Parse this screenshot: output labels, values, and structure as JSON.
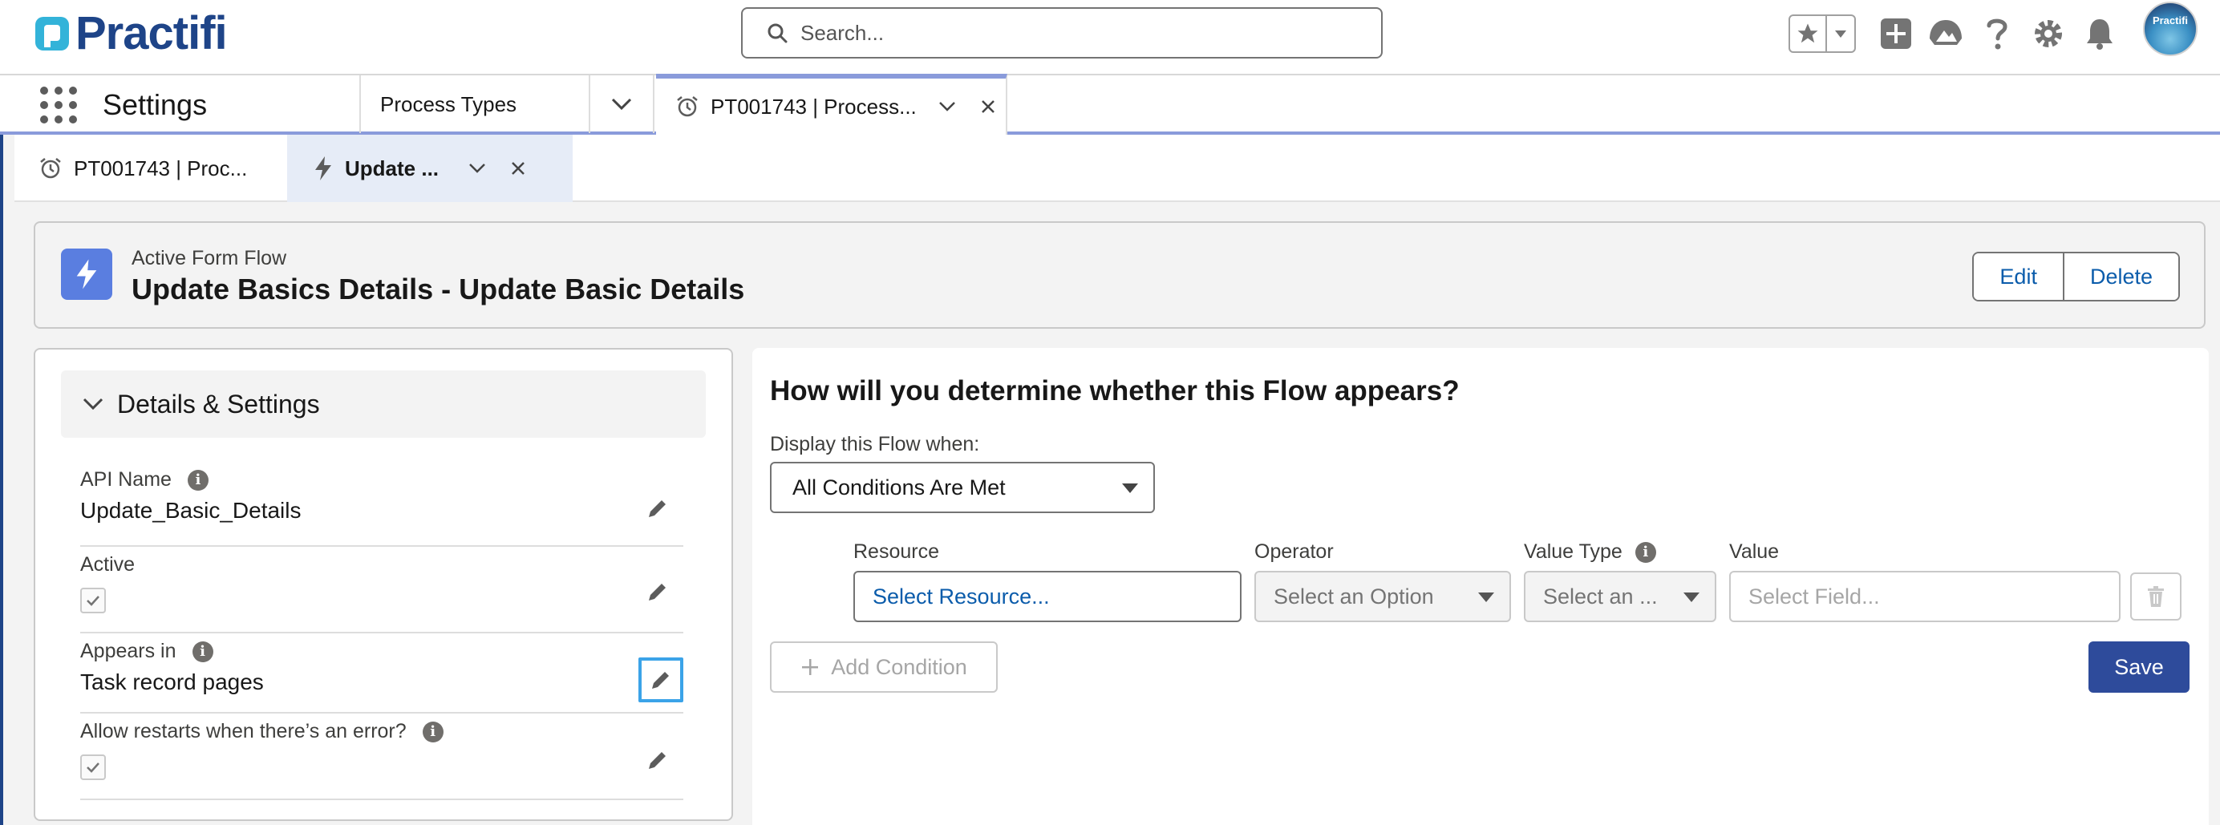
{
  "brand": {
    "logo_text": "Practifi",
    "logo_icon": "practifi-logo-icon",
    "avatar_text": "Practifi"
  },
  "search": {
    "placeholder": "Search..."
  },
  "header_icons": [
    "favorites-star-icon",
    "add-icon",
    "trailhead-icon",
    "help-icon",
    "setup-gear-icon",
    "notifications-bell-icon"
  ],
  "app_nav": {
    "app_name": "Settings",
    "items": [
      {
        "label": "Process Types"
      },
      {
        "label": "PT001743 | Process..."
      }
    ]
  },
  "subtabs": [
    {
      "label": "PT001743 | Proc...",
      "icon": "alarm-clock-icon"
    },
    {
      "label": "Update ...",
      "icon": "lightning-bolt-icon"
    }
  ],
  "record": {
    "type": "Active Form Flow",
    "title": "Update Basics Details - Update Basic Details",
    "edit_label": "Edit",
    "delete_label": "Delete"
  },
  "details": {
    "section_title": "Details & Settings",
    "fields": [
      {
        "label": "API Name",
        "value": "Update_Basic_Details",
        "info": "i"
      },
      {
        "label": "Active",
        "checked": true
      },
      {
        "label": "Appears in",
        "value": "Task record pages",
        "info": "i"
      },
      {
        "label": "Allow restarts when there’s an error?",
        "checked": true,
        "info": "i"
      }
    ]
  },
  "conditions": {
    "question": "How will you determine whether this Flow appears?",
    "display_label": "Display this Flow when:",
    "display_value": "All Conditions Are Met",
    "columns": {
      "resource": "Resource",
      "operator": "Operator",
      "value_type": "Value Type",
      "value": "Value"
    },
    "row": {
      "resource_placeholder": "Select Resource...",
      "operator_placeholder": "Select an Option",
      "value_type_placeholder": "Select an ...",
      "value_placeholder": "Select Field..."
    },
    "add_condition_label": "Add Condition",
    "save_label": "Save"
  },
  "colors": {
    "brand_blue": "#1e4488",
    "link_blue": "#0b5cab",
    "save_button": "#2e4b9b",
    "flow_icon_bg": "#5a7ee0",
    "active_tab_accent": "#8a9bdb"
  }
}
